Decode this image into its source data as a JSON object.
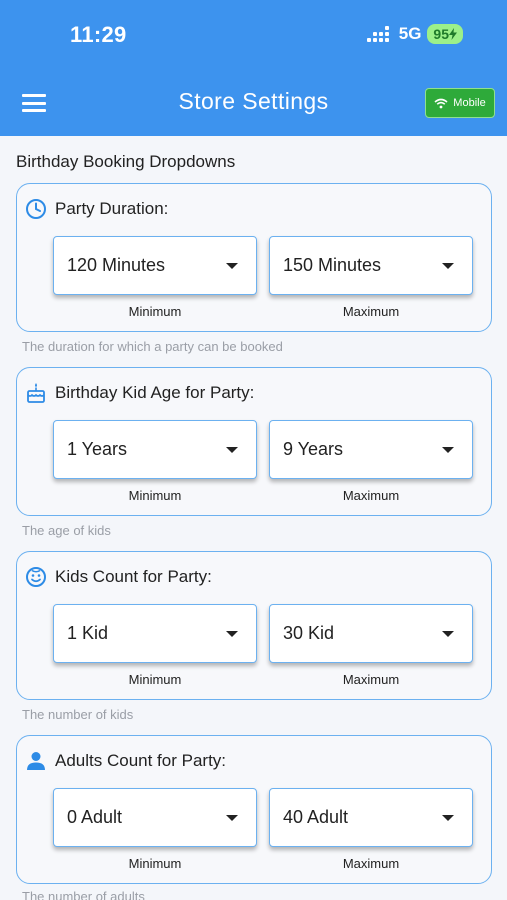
{
  "status_bar": {
    "time": "11:29",
    "network": "5G",
    "battery": "95"
  },
  "header": {
    "title": "Store Settings",
    "mobile_badge": "Mobile"
  },
  "section_title": "Birthday Booking Dropdowns",
  "colors": {
    "header": "#3d93ee",
    "accent": "#6cb1f0",
    "badge": "#2eaa3a"
  },
  "cards": [
    {
      "icon": "clock-icon",
      "title": "Party Duration:",
      "min": "120 Minutes",
      "max": "150 Minutes",
      "min_label": "Minimum",
      "max_label": "Maximum",
      "hint": "The duration for which a party can be booked"
    },
    {
      "icon": "cake-icon",
      "title": "Birthday Kid Age for Party:",
      "min": "1 Years",
      "max": "9 Years",
      "min_label": "Minimum",
      "max_label": "Maximum",
      "hint": "The age of kids"
    },
    {
      "icon": "smiley-icon",
      "title": "Kids Count for Party:",
      "min": "1 Kid",
      "max": "30 Kid",
      "min_label": "Minimum",
      "max_label": "Maximum",
      "hint": "The number of kids"
    },
    {
      "icon": "person-icon",
      "title": "Adults Count for Party:",
      "min": "0 Adult",
      "max": "40 Adult",
      "min_label": "Minimum",
      "max_label": "Maximum",
      "hint": "The number of adults"
    }
  ]
}
